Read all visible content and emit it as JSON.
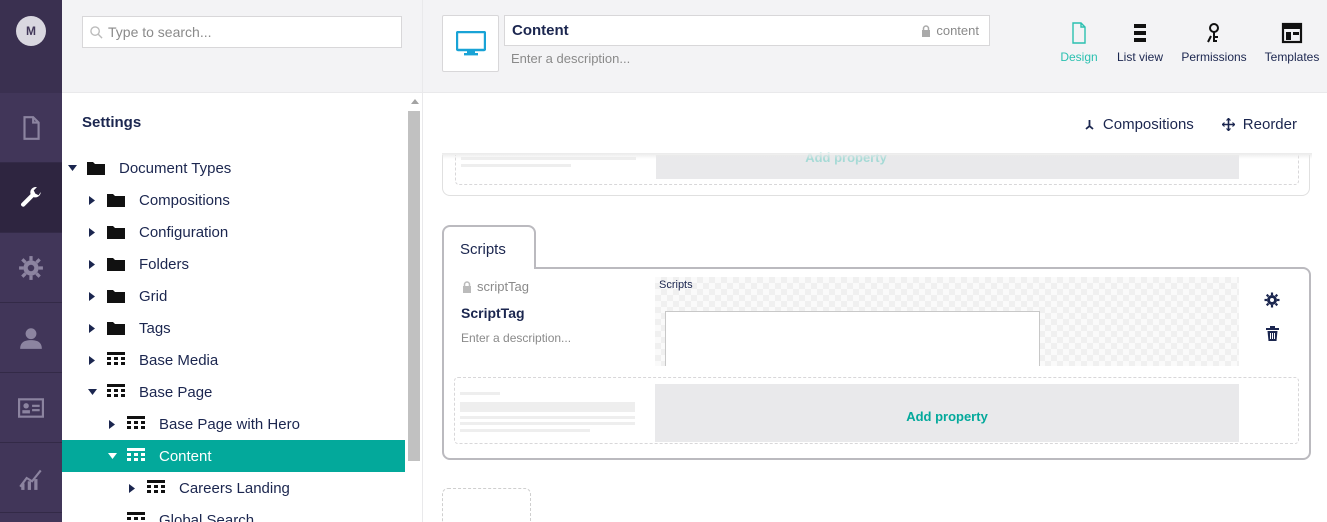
{
  "user": {
    "initial": "M"
  },
  "sections": [
    {
      "name": "content",
      "icon": "document-icon",
      "active": false
    },
    {
      "name": "settings",
      "icon": "wrench-icon",
      "active": true
    },
    {
      "name": "packages",
      "icon": "gear-icon",
      "active": false
    },
    {
      "name": "users",
      "icon": "user-icon",
      "active": false
    },
    {
      "name": "members",
      "icon": "id-card-icon",
      "active": false
    },
    {
      "name": "analytics",
      "icon": "chart-icon",
      "active": false
    }
  ],
  "tree": {
    "search_placeholder": "Type to search...",
    "heading": "Settings",
    "nodes": [
      {
        "label": "Document Types",
        "depth": 0,
        "icon": "folder-icon",
        "expanded": true
      },
      {
        "label": "Compositions",
        "depth": 1,
        "icon": "folder-icon",
        "expanded": false
      },
      {
        "label": "Configuration",
        "depth": 1,
        "icon": "folder-icon",
        "expanded": false
      },
      {
        "label": "Folders",
        "depth": 1,
        "icon": "folder-icon",
        "expanded": false
      },
      {
        "label": "Grid",
        "depth": 1,
        "icon": "folder-icon",
        "expanded": false
      },
      {
        "label": "Tags",
        "depth": 1,
        "icon": "folder-icon",
        "expanded": false
      },
      {
        "label": "Base Media",
        "depth": 1,
        "icon": "doctype-icon",
        "expanded": false
      },
      {
        "label": "Base Page",
        "depth": 1,
        "icon": "doctype-icon",
        "expanded": true
      },
      {
        "label": "Base Page with Hero",
        "depth": 2,
        "icon": "doctype-icon",
        "expanded": false
      },
      {
        "label": "Content",
        "depth": 2,
        "icon": "doctype-icon",
        "expanded": true,
        "active": true
      },
      {
        "label": "Careers Landing",
        "depth": 3,
        "icon": "doctype-icon",
        "expanded": false
      },
      {
        "label": "Global Search",
        "depth": 2,
        "icon": "doctype-icon",
        "expanded": null
      }
    ]
  },
  "header": {
    "icon": "monitor-icon",
    "name_value": "Content",
    "alias": "content",
    "description_placeholder": "Enter a description...",
    "apps": [
      {
        "label": "Design",
        "icon": "document-outline-icon",
        "active": true
      },
      {
        "label": "List view",
        "icon": "list-view-icon",
        "active": false
      },
      {
        "label": "Permissions",
        "icon": "permissions-icon",
        "active": false
      },
      {
        "label": "Templates",
        "icon": "templates-icon",
        "active": false
      }
    ]
  },
  "toolbar": {
    "compositions": "Compositions",
    "reorder": "Reorder"
  },
  "groups": {
    "previous_add_property": "Add property",
    "tab_label": "Scripts",
    "property": {
      "alias": "scriptTag",
      "name": "ScriptTag",
      "description_placeholder": "Enter a description...",
      "editor_label": "Scripts"
    },
    "add_property": "Add property"
  },
  "colors": {
    "accent": "#03a99b",
    "sidebar": "#413659",
    "text": "#1b264f"
  }
}
